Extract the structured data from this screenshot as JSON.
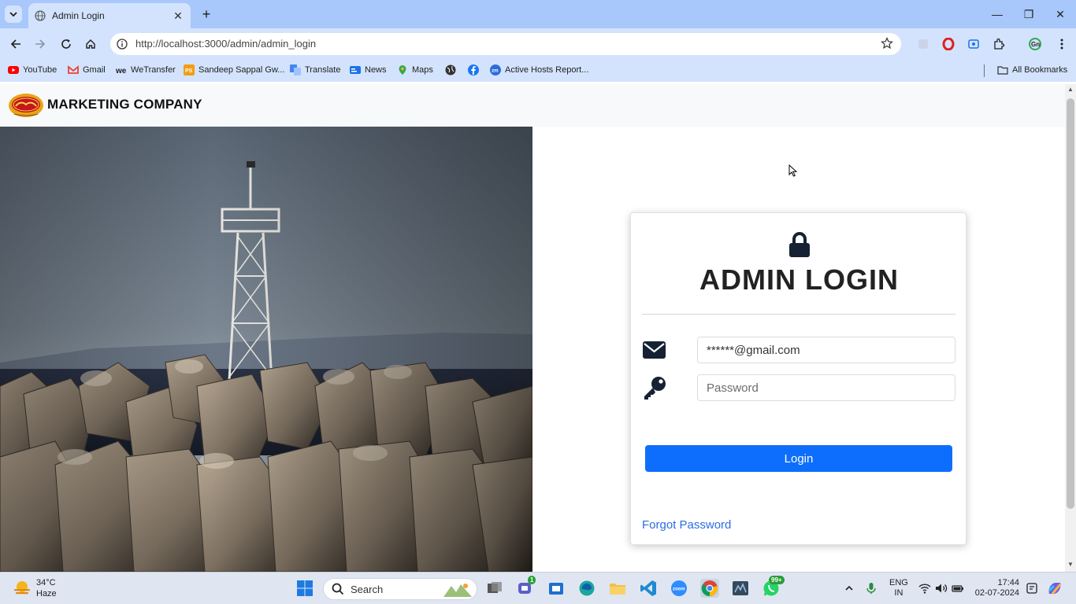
{
  "browser": {
    "tab_title": "Admin Login",
    "url": "http://localhost:3000/admin/admin_login",
    "bookmarks": [
      {
        "label": "YouTube",
        "icon": "youtube-icon"
      },
      {
        "label": "Gmail",
        "icon": "gmail-icon"
      },
      {
        "label": "WeTransfer",
        "icon": "wetransfer-icon"
      },
      {
        "label": "Sandeep Sappal Gw...",
        "icon": "ps-icon"
      },
      {
        "label": "Translate",
        "icon": "translate-icon"
      },
      {
        "label": "News",
        "icon": "news-icon"
      },
      {
        "label": "Maps",
        "icon": "maps-icon"
      },
      {
        "label": "",
        "icon": "globe-icon"
      },
      {
        "label": "",
        "icon": "facebook-icon"
      },
      {
        "label": "Active Hosts Report...",
        "icon": "zm-icon"
      }
    ],
    "all_bookmarks": "All Bookmarks"
  },
  "navbar": {
    "brand": "MARKETING COMPANY"
  },
  "login": {
    "title": "ADMIN LOGIN",
    "email_value": "******@gmail.com",
    "password_placeholder": "Password",
    "button_label": "Login",
    "forgot_label": "Forgot Password",
    "accent_color": "#0d6efd"
  },
  "taskbar": {
    "temperature": "34°C",
    "condition": "Haze",
    "search_label": "Search",
    "teams_badge": "1",
    "whatsapp_badge": "99+",
    "language_line1": "ENG",
    "language_line2": "IN",
    "time": "17:44",
    "date": "02-07-2024"
  }
}
